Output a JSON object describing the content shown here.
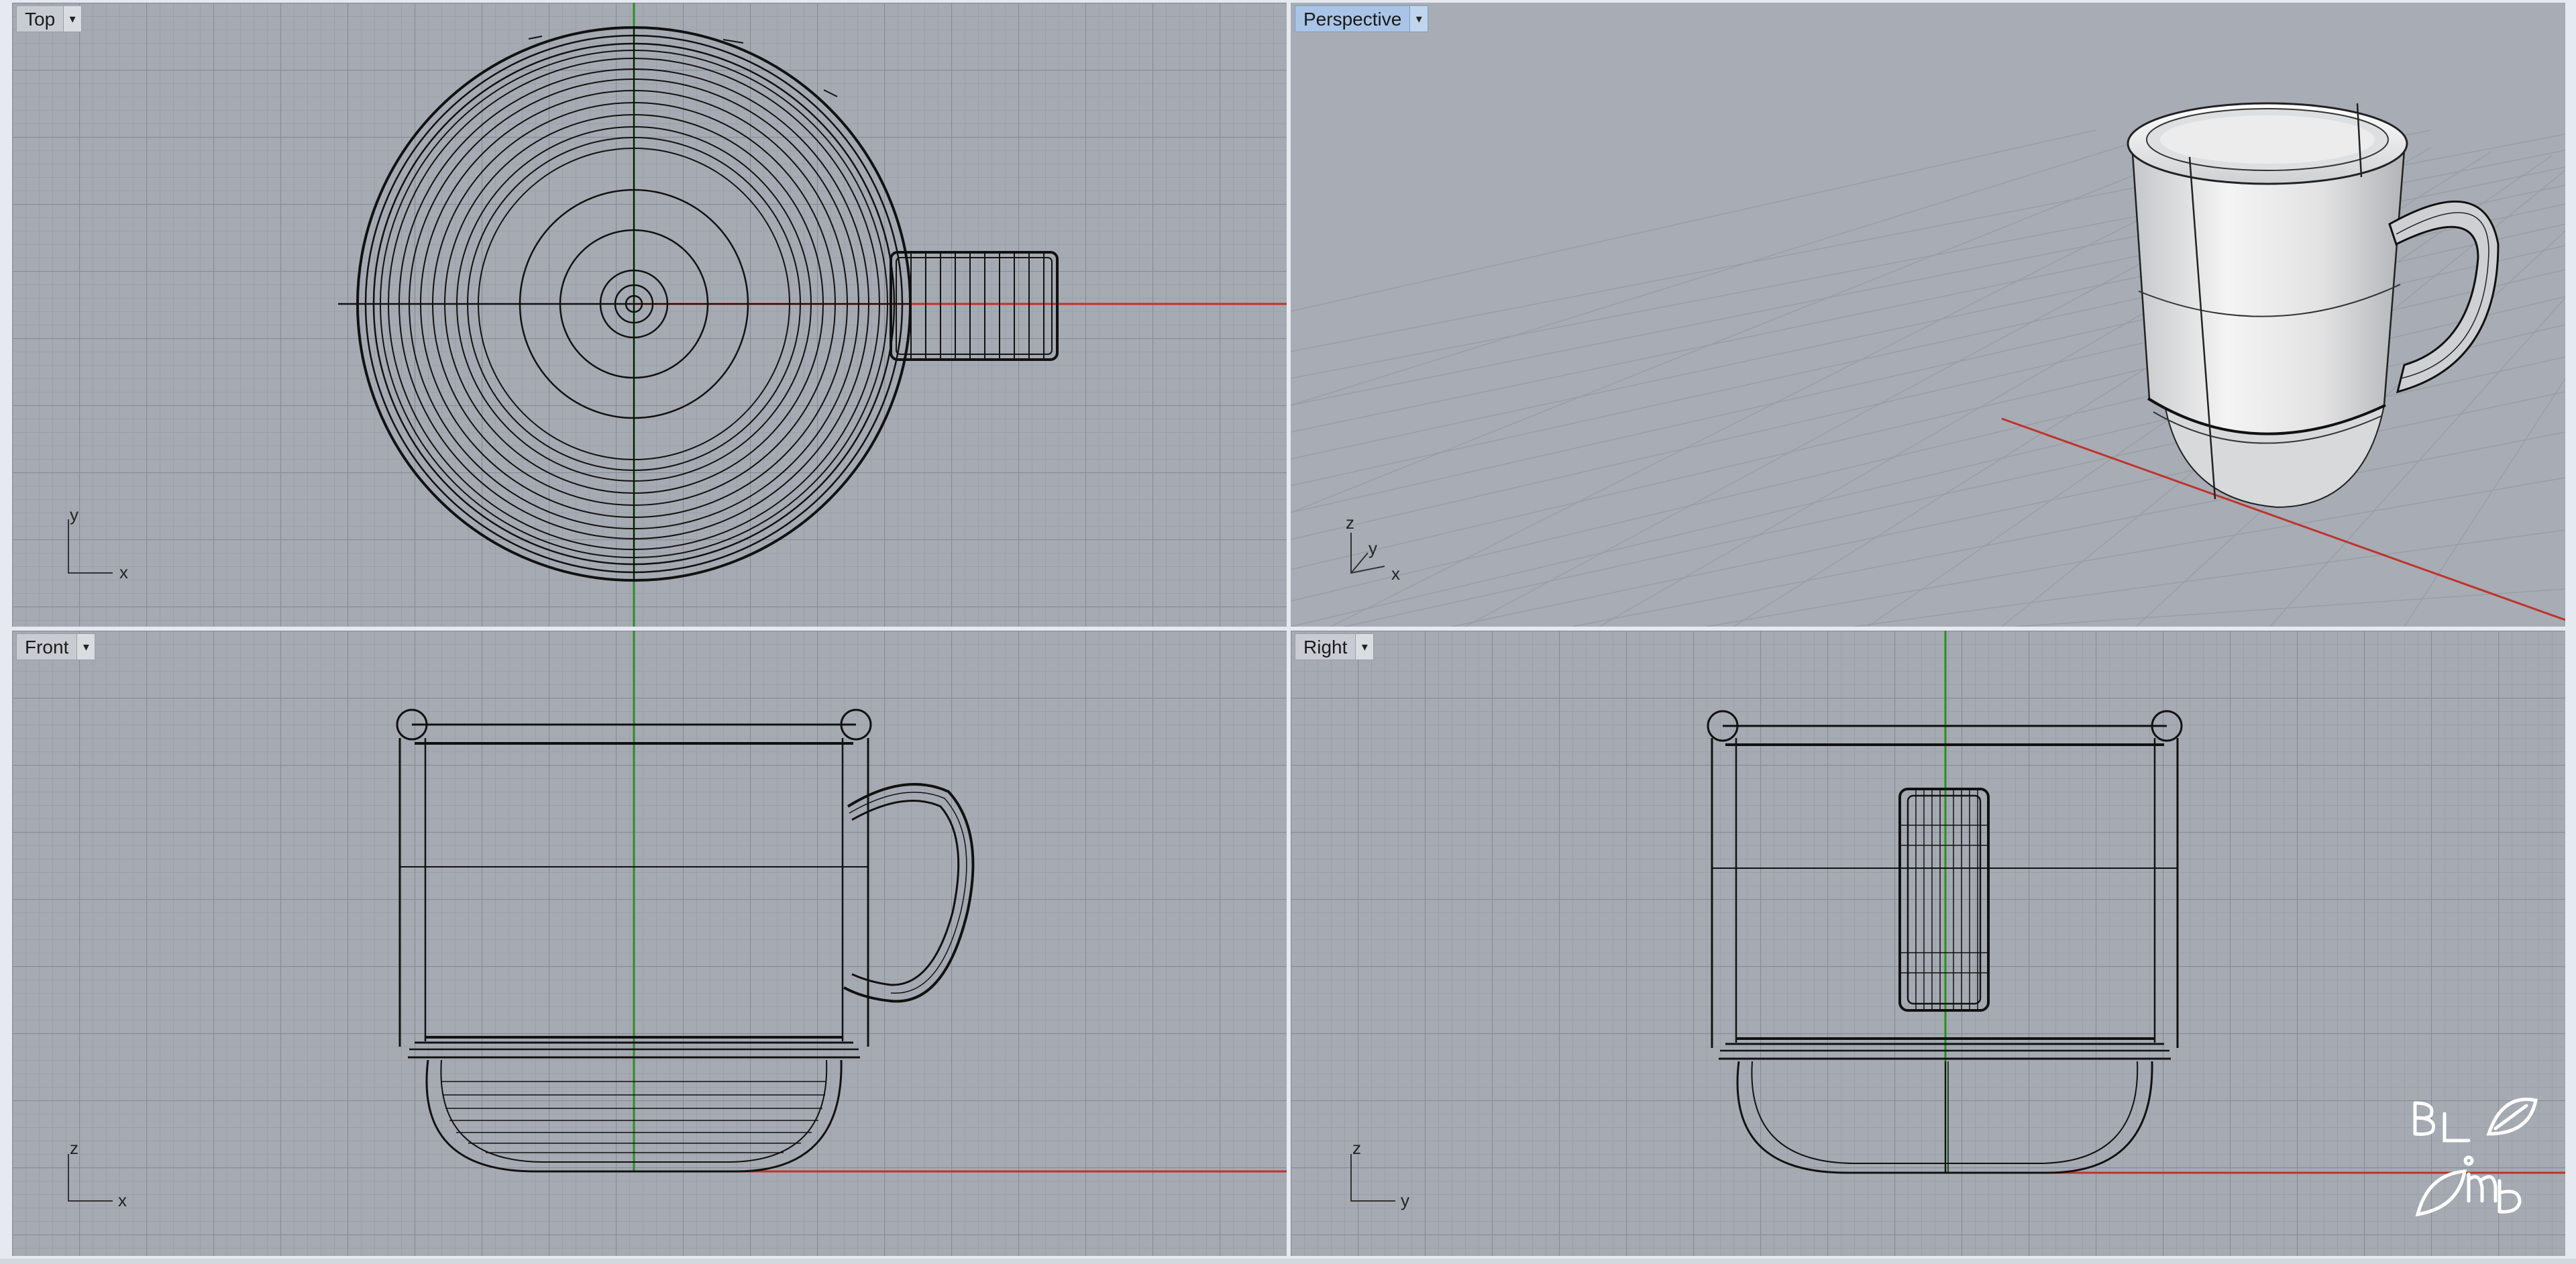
{
  "viewports": {
    "top": {
      "title": "Top",
      "axis_x": "x",
      "axis_y": "y"
    },
    "perspective": {
      "title": "Perspective",
      "axis_x": "x",
      "axis_y": "y",
      "axis_z": "z"
    },
    "front": {
      "title": "Front",
      "axis_x": "x",
      "axis_z": "z"
    },
    "right": {
      "title": "Right",
      "axis_y": "y",
      "axis_z": "z"
    }
  },
  "icons": {
    "dropdown": "chevron-down-icon",
    "logo": "blmd-logo"
  },
  "colors": {
    "viewport_bg": "#a6aab2",
    "grid_minor": "#9a9ea6",
    "grid_major": "#868a92",
    "x_axis": "#c0332b",
    "y_axis": "#2a8c2a",
    "wire": "#111111",
    "active_title": "#a9c4e6"
  }
}
